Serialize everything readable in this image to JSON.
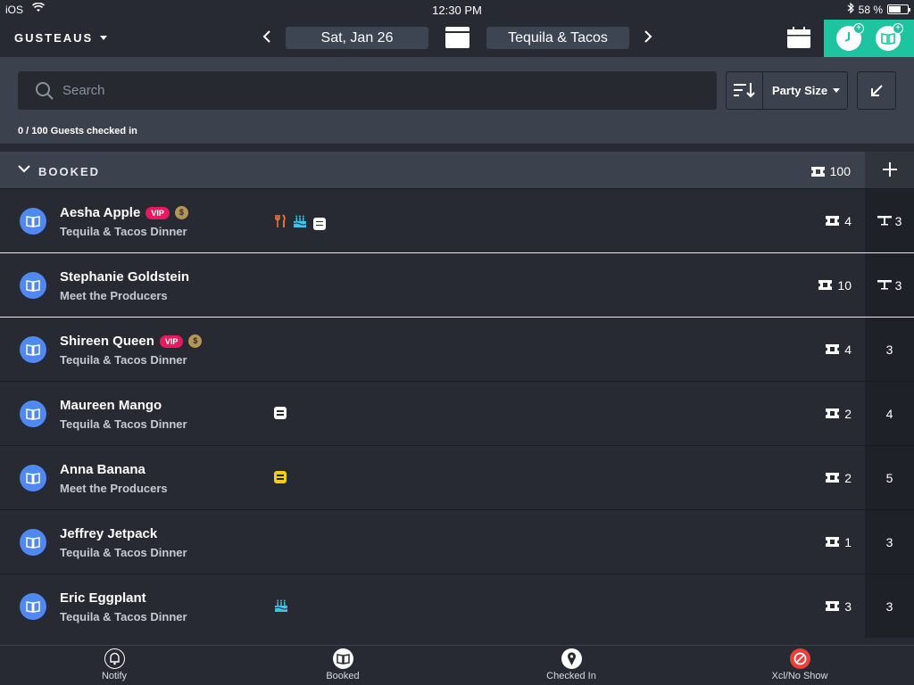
{
  "status_bar": {
    "carrier": "iOS",
    "time": "12:30 PM",
    "battery": "58 %"
  },
  "header": {
    "venue": "GUSTEAUS",
    "date": "Sat, Jan 26",
    "event": "Tequila & Tacos"
  },
  "search": {
    "placeholder": "Search"
  },
  "sort": {
    "label": "Party Size"
  },
  "checked_in_text": "0 / 100 Guests checked in",
  "section": {
    "title": "BOOKED",
    "count": "100"
  },
  "guests": [
    {
      "name": "Aesha Apple",
      "event": "Tequila & Tacos Dinner",
      "vip": "VIP",
      "coin": "$",
      "party": "4",
      "table": "3",
      "tags": [
        "fork-knife-icon",
        "cake-icon",
        "note-icon"
      ]
    },
    {
      "name": "Stephanie Goldstein",
      "event": "Meet the Producers",
      "party": "10",
      "table": "3",
      "tags": []
    },
    {
      "name": "Shireen Queen",
      "event": "Tequila & Tacos Dinner",
      "vip": "VIP",
      "coin": "$",
      "party": "4",
      "table": "3",
      "tags": []
    },
    {
      "name": "Maureen Mango",
      "event": "Tequila & Tacos Dinner",
      "party": "2",
      "table": "4",
      "tags": [
        "note-icon"
      ]
    },
    {
      "name": "Anna Banana",
      "event": "Meet the Producers",
      "party": "2",
      "table": "5",
      "tags": [
        "note-yellow-icon"
      ]
    },
    {
      "name": "Jeffrey Jetpack",
      "event": "Tequila & Tacos Dinner",
      "party": "1",
      "table": "3",
      "tags": []
    },
    {
      "name": "Eric Eggplant",
      "event": "Tequila & Tacos Dinner",
      "party": "3",
      "table": "3",
      "tags": [
        "cake-icon"
      ]
    }
  ],
  "tabs": [
    {
      "label": "Notify",
      "icon": "bell-icon"
    },
    {
      "label": "Booked",
      "icon": "book-icon"
    },
    {
      "label": "Checked In",
      "icon": "pin-icon"
    },
    {
      "label": "Xcl/No Show",
      "icon": "cancel-icon"
    }
  ],
  "colors": {
    "accent": "#1ec4a0",
    "avatar": "#4f88f0",
    "vip": "#e8195c",
    "cancel": "#ef3e3a"
  }
}
